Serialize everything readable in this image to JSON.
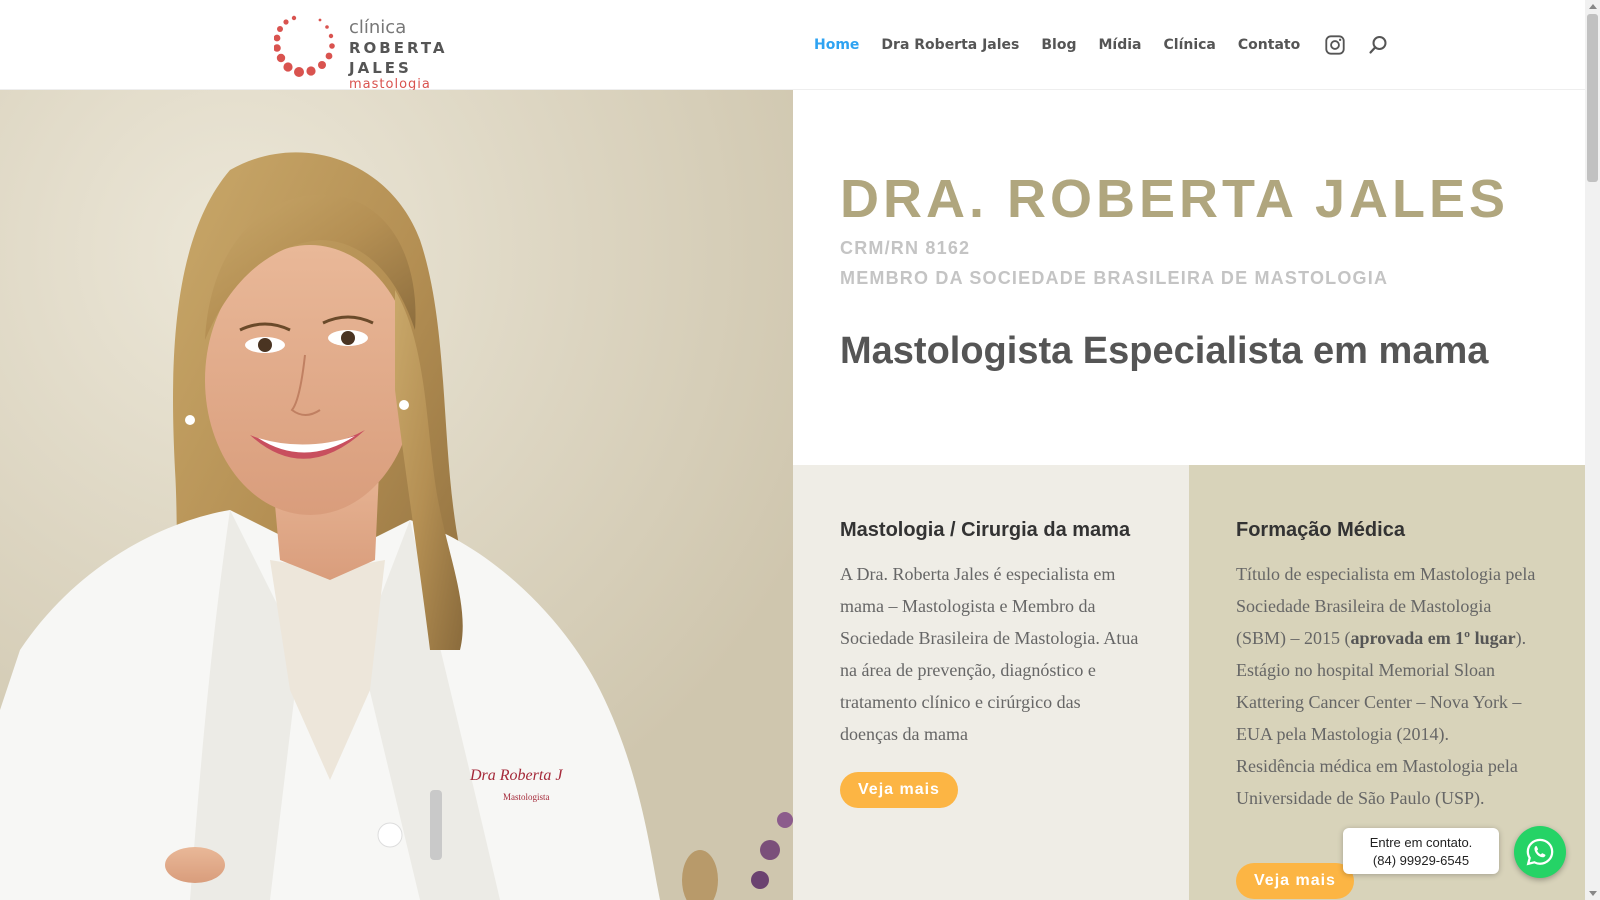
{
  "header": {
    "logo": {
      "line1": "clínica",
      "line2": "ROBERTA JALES",
      "line3": "mastologia"
    },
    "nav": [
      {
        "label": "Home",
        "active": true
      },
      {
        "label": "Dra Roberta Jales",
        "active": false
      },
      {
        "label": "Blog",
        "active": false
      },
      {
        "label": "Mídia",
        "active": false
      },
      {
        "label": "Clínica",
        "active": false
      },
      {
        "label": "Contato",
        "active": false
      }
    ],
    "icons": {
      "social": "instagram-icon",
      "search": "search-icon"
    }
  },
  "photo": {
    "coat_text_1": "Dra Roberta J",
    "coat_text_2": "Mastologista"
  },
  "hero": {
    "title": "DRA. ROBERTA JALES",
    "crm": "CRM/RN 8162",
    "member": "MEMBRO DA SOCIEDADE BRASILEIRA DE MASTOLOGIA",
    "subtitle": "Mastologista Especialista em mama"
  },
  "cards": [
    {
      "title": "Mastologia / Cirurgia da mama",
      "body": "A Dra. Roberta Jales é especialista em mama – Mastologista e Membro da Sociedade Brasileira de Mastologia. Atua na área de prevenção, diagnóstico e tratamento clínico e cirúrgico das doenças da mama",
      "button": "Veja mais"
    },
    {
      "title": "Formação Médica",
      "body_p1_pre": "Título de especialista em Mastologia pela Sociedade Brasileira de Mastologia (SBM) – 2015 (",
      "body_p1_bold": "aprovada em 1º lugar",
      "body_p1_post": ").",
      "body_p2": "Estágio no hospital Memorial Sloan Kattering Cancer Center – Nova York –EUA pela Mastologia (2014).",
      "body_p3": "Residência médica em Mastologia pela Universidade de São Paulo (USP).",
      "button": "Veja mais"
    }
  ],
  "whatsapp": {
    "line1": "Entre em contato.",
    "line2": "(84) 99929-6545",
    "icon": "whatsapp-icon"
  },
  "colors": {
    "accent_blue": "#2ea3f2",
    "title_gold": "#b0a67e",
    "button_orange": "#fcb544",
    "card_left_bg": "#efede6",
    "card_right_bg": "#d8d3ba",
    "logo_red": "#d9534f",
    "whatsapp_green": "#25d366"
  }
}
